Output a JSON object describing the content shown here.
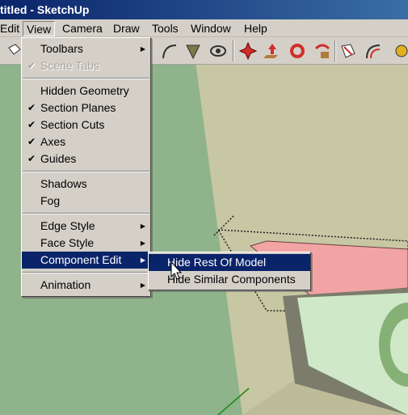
{
  "window": {
    "title": "titled - SketchUp"
  },
  "menubar": {
    "items": [
      {
        "label": "Edit"
      },
      {
        "label": "View"
      },
      {
        "label": "Camera"
      },
      {
        "label": "Draw"
      },
      {
        "label": "Tools"
      },
      {
        "label": "Window"
      },
      {
        "label": "Help"
      }
    ]
  },
  "toolbar": {
    "icons": [
      "select-icon",
      "arc-icon",
      "paint-bucket-icon",
      "orbit-icon",
      "move-icon",
      "push-pull-icon",
      "rotate-icon",
      "follow-me-icon",
      "scale-icon",
      "offset-icon",
      "tape-measure-icon"
    ]
  },
  "view_menu": {
    "items": [
      {
        "label": "Toolbars"
      },
      {
        "label": "Scene Tabs"
      },
      {
        "label": "Hidden Geometry"
      },
      {
        "label": "Section Planes"
      },
      {
        "label": "Section Cuts"
      },
      {
        "label": "Axes"
      },
      {
        "label": "Guides"
      },
      {
        "label": "Shadows"
      },
      {
        "label": "Fog"
      },
      {
        "label": "Edge Style"
      },
      {
        "label": "Face Style"
      },
      {
        "label": "Component Edit"
      },
      {
        "label": "Animation"
      }
    ]
  },
  "component_edit_submenu": {
    "items": [
      {
        "label": "Hide Rest Of Model"
      },
      {
        "label": "Hide Similar Components"
      }
    ]
  },
  "colors": {
    "title_bar": "#0a246a",
    "menu_face": "#d4d0c8",
    "highlight": "#0a246a",
    "ground": "#8fb38a",
    "sky_plane": "#c7c7a4",
    "section_plane": "#f2a4a4"
  }
}
